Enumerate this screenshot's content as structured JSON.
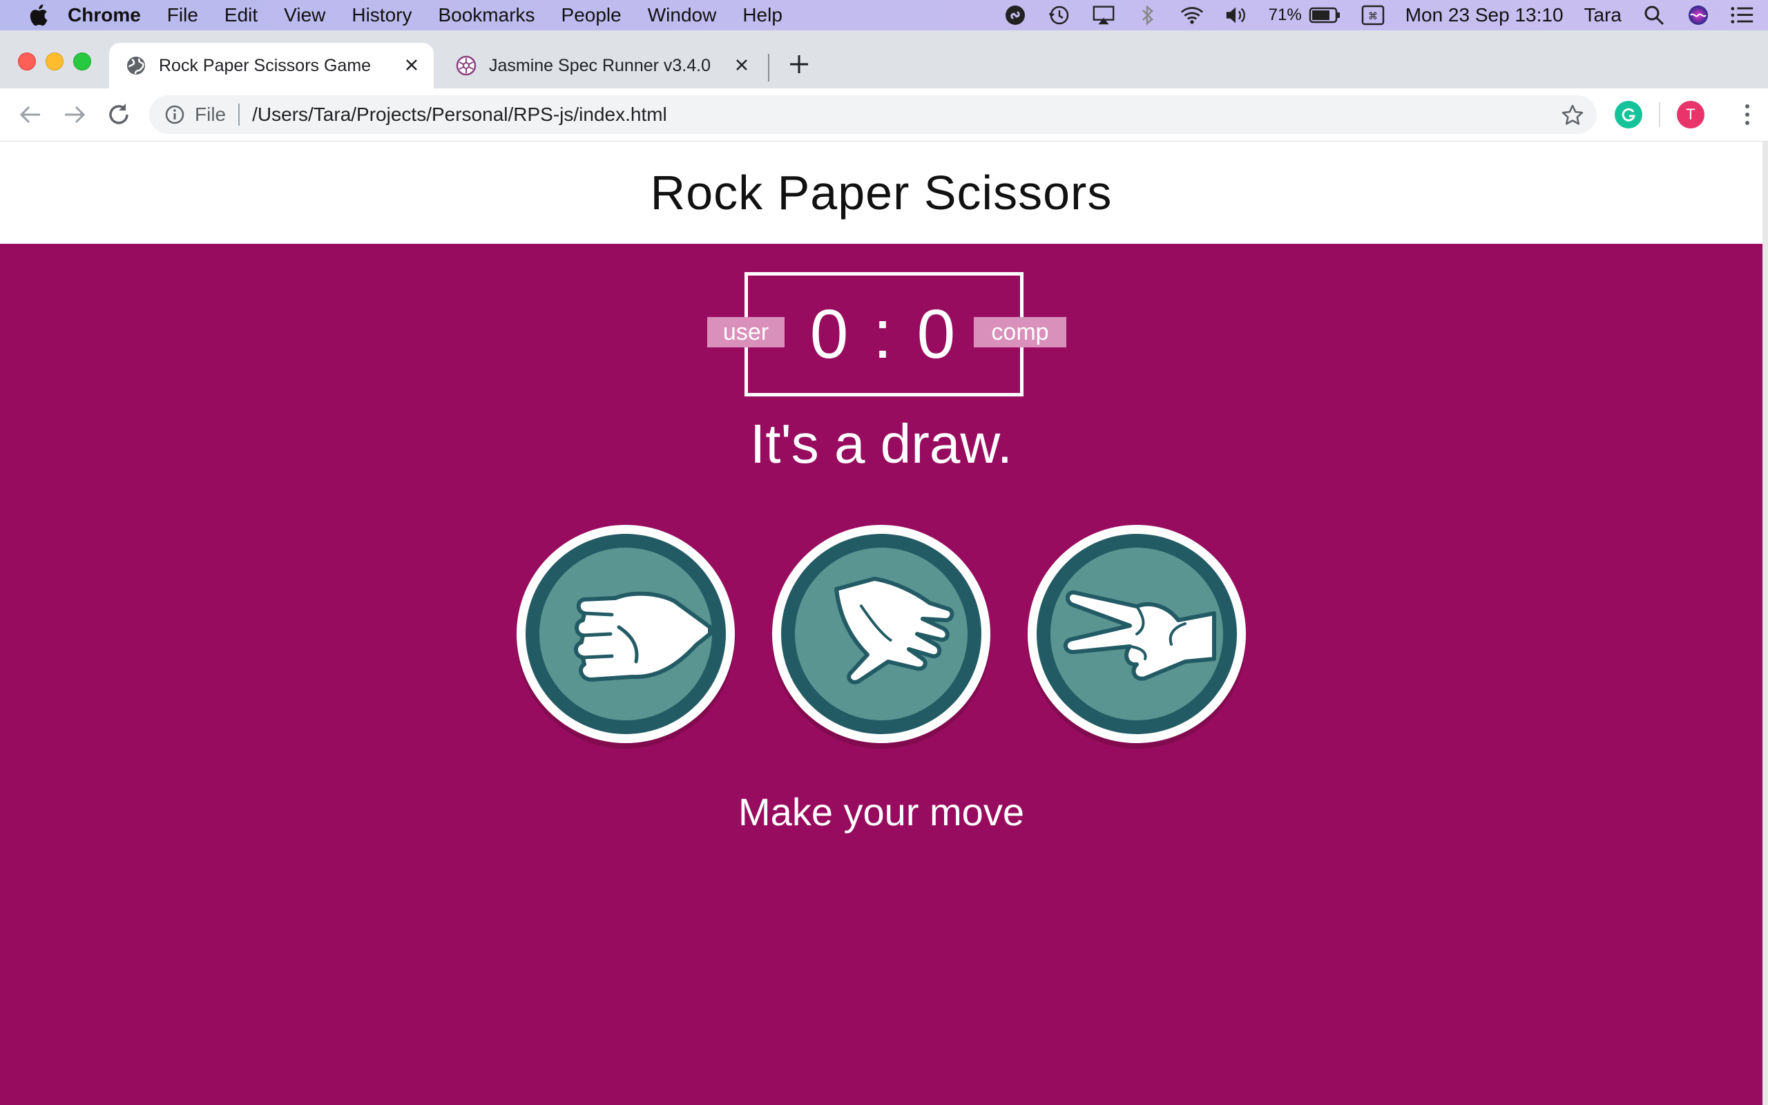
{
  "menubar": {
    "app": "Chrome",
    "items": [
      "File",
      "Edit",
      "View",
      "History",
      "Bookmarks",
      "People",
      "Window",
      "Help"
    ],
    "battery": "71%",
    "datetime": "Mon 23 Sep  13:10",
    "user": "Tara"
  },
  "tabs": [
    {
      "title": "Rock Paper Scissors Game",
      "active": true
    },
    {
      "title": "Jasmine Spec Runner v3.4.0",
      "active": false
    }
  ],
  "toolbar": {
    "scheme_label": "File",
    "url": "/Users/Tara/Projects/Personal/RPS-js/index.html",
    "profile_initial": "T"
  },
  "page": {
    "title": "Rock Paper Scissors",
    "score": {
      "user_label": "user",
      "comp_label": "comp",
      "display": "0 : 0",
      "user": 0,
      "comp": 0
    },
    "result": "It's a draw.",
    "choices": [
      {
        "name": "rock",
        "icon": "rock-fist-icon"
      },
      {
        "name": "paper",
        "icon": "paper-hand-icon"
      },
      {
        "name": "scissors",
        "icon": "scissors-hand-icon"
      }
    ],
    "prompt": "Make your move"
  },
  "colors": {
    "game_bg": "#970c5e",
    "badge_bg": "#d990bb",
    "choice_fill": "#5a9591",
    "choice_ring": "#235b64"
  }
}
